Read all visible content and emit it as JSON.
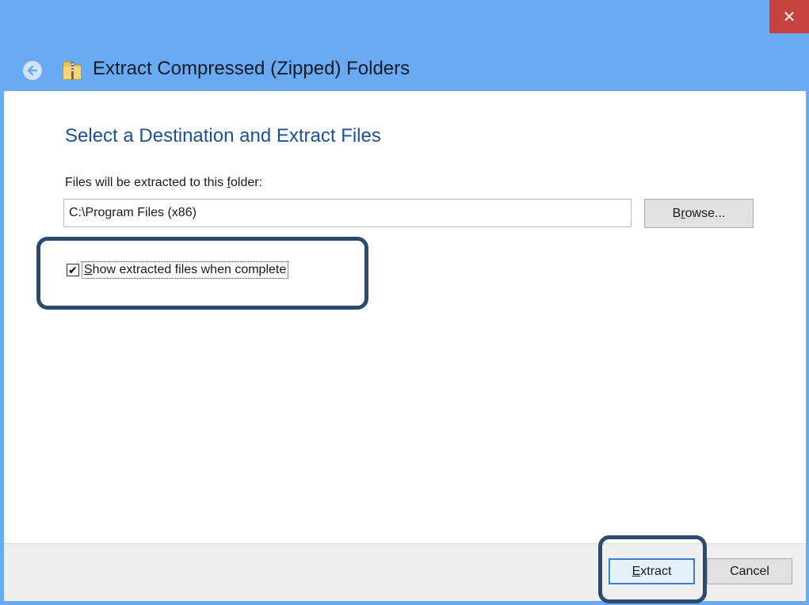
{
  "window": {
    "title": "Extract Compressed (Zipped) Folders",
    "close_glyph": "✕",
    "back_icon": "back-arrow-icon",
    "folder_icon": "zip-folder-icon",
    "accent_color": "#6aaaf3",
    "close_color": "#c9433e"
  },
  "main": {
    "heading": "Select a Destination and Extract Files",
    "dest_label_pre": "Files will be extracted to this ",
    "dest_label_key": "f",
    "dest_label_post": "older:",
    "path_value": "C:\\Program Files (x86)",
    "browse_pre": "B",
    "browse_key": "r",
    "browse_post": "owse...",
    "show_files_checked": true,
    "checkbox_glyph": "✔",
    "show_files_key": "S",
    "show_files_post": "how extracted files when complete"
  },
  "footer": {
    "extract_key": "E",
    "extract_post": "xtract",
    "cancel_label": "Cancel"
  },
  "annotations": {
    "highlight_color": "#2c4a6e"
  }
}
